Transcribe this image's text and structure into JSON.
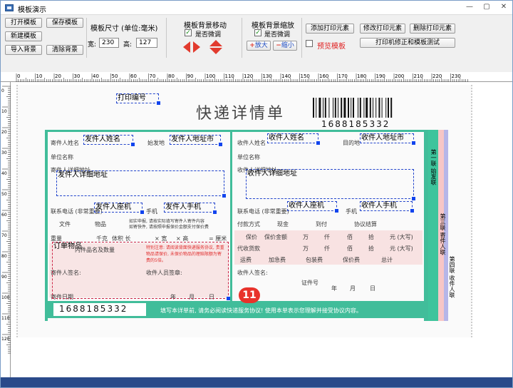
{
  "window": {
    "title": "模板演示",
    "controls": [
      "—",
      "▢",
      "✕"
    ]
  },
  "toolbar": {
    "open_template": "打开模板",
    "save_template": "保存模板",
    "new_template": "新建模板",
    "import_background": "导入背景",
    "clear_background": "清除背景",
    "size_title": "模板尺寸 (单位:毫米)",
    "width_label": "宽:",
    "width_value": "230",
    "height_label": "高:",
    "height_value": "127",
    "bg_move_title": "模板背景移动",
    "bg_move_fine": "是否微调",
    "bg_zoom_title": "模板背景缩放",
    "bg_zoom_fine": "是否微调",
    "zoom_in": "放大",
    "zoom_out": "缩小",
    "add_element": "添加打印元素",
    "modify_element": "修改打印元素",
    "delete_element": "删除打印元素",
    "preview_template": "预览模板",
    "printer_test": "打印机修正和模板测试"
  },
  "ruler": {
    "h_ticks": [
      "0",
      "10",
      "20",
      "30",
      "40",
      "50",
      "60",
      "70",
      "80",
      "90",
      "100",
      "110",
      "120",
      "130",
      "140",
      "150",
      "160",
      "170",
      "180",
      "190",
      "200",
      "210",
      "220",
      "230"
    ],
    "v_ticks": [
      "0",
      "10",
      "20",
      "30",
      "40",
      "50",
      "60",
      "70",
      "80",
      "90",
      "100",
      "110",
      "120"
    ]
  },
  "sheet": {
    "title": "快递详情单",
    "tracking": "1688185332",
    "sender_name": "寄件人姓名",
    "origin": "始发地",
    "receiver_name": "收件人姓名",
    "destination": "目的地",
    "company": "单位名称",
    "sender_address": "寄件人详细地址",
    "receiver_address": "收件人详细地址",
    "sender_phone": "联系电话 (非常重要)",
    "receiver_phone": "联系电话 (非常重要)",
    "mobile": "手机",
    "doc": "文件",
    "goods": "物品",
    "notice1": "如实申报, 请按实际填写寄件人寄件内容",
    "notice2": "如寄快件, 请按照申报保价金额支付保价费",
    "payment_method": "付款方式",
    "cash": "现金",
    "cod": "到付",
    "agreement": "协议结算",
    "weight": "重量",
    "kg": "千克",
    "volume": "体积 长",
    "width_mark": "× 宽",
    "height_mark": "× 高",
    "cm": "= 厘米",
    "insured": "保价",
    "insured_amount": "保价金额",
    "wan": "万",
    "qian": "仟",
    "bai": "佰",
    "shi": "拾",
    "yuan": "元 (大写)",
    "cod_amount": "代收货款",
    "freight": "运费",
    "surcharge": "加急费",
    "packing": "包装费",
    "insurance_fee": "保价费",
    "total": "总计",
    "contents": "内件品名及数量",
    "special_notice": "特别注意: 请阅读背面快递服务协议, 贵重物品请保价, 未保价物品的理赔限额为寄费的5倍。",
    "sender_sign": "寄件人签名:",
    "collector_sign": "收件人员签章:",
    "receiver_sign": "收件人签名:",
    "id_no": "证件号",
    "date_ymd": [
      "年",
      "月",
      "日"
    ],
    "collect_time": "寄件日期",
    "footer_text": "填写本详单前, 请务必阅读快递服务协议! 使用本单表示您理解并接受协议内容。",
    "side_labels": [
      "第一联 始发联",
      "第二联 签收联",
      "第三联 寄件人联",
      "第四联 收件人联"
    ]
  },
  "elements": {
    "print_no": "打印编号",
    "sender_name_el": "发件人姓名",
    "sender_addr_el": "发件人地址市",
    "sender_detail_el": "发件人详细地址",
    "sender_tel_el": "发件人座机",
    "sender_mobile_el": "发件人手机",
    "receiver_name_el": "收件人姓名",
    "receiver_addr_el": "收件人地址市",
    "receiver_detail_el": "收件人详细地址",
    "receiver_tel_el": "收件人座机",
    "receiver_mobile_el": "收件人手机",
    "goods_el": "订单物品"
  },
  "badge": "11",
  "colors": {
    "accent_green": "#41bd9a",
    "element_border": "#2244cc",
    "badge_red": "#e8322b",
    "preview_red": "#e02020"
  }
}
